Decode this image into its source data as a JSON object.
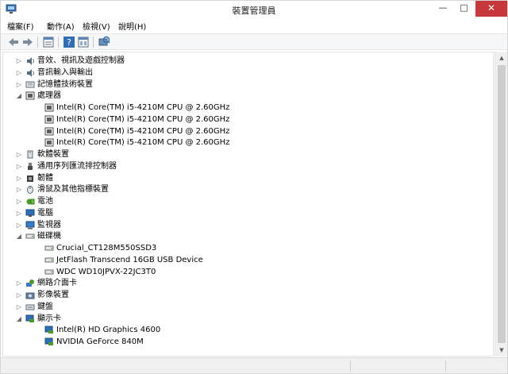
{
  "window": {
    "title": "裝置管理員",
    "buttons": {
      "minimize": "—",
      "maximize": "□",
      "close": "✕"
    }
  },
  "menu": {
    "items": [
      "檔案(F)",
      "動作(A)",
      "檢視(V)",
      "說明(H)"
    ]
  },
  "toolbar": {
    "buttons": [
      "back-icon",
      "forward-icon",
      "properties-icon",
      "help-icon",
      "view-icon",
      "scan-hardware-icon"
    ]
  },
  "tree": {
    "rows": [
      {
        "label": "音效、視訊及遊戲控制器",
        "expander": "▷",
        "icon": "speaker-icon"
      },
      {
        "label": "音訊輸入與輸出",
        "expander": "▷",
        "icon": "speaker-icon"
      },
      {
        "label": "記憶體技術裝置",
        "expander": "▷",
        "icon": "memory-icon"
      },
      {
        "label": "處理器",
        "expander": "◢",
        "icon": "processor-icon"
      },
      {
        "label": "Intel(R) Core(TM) i5-4210M CPU @ 2.60GHz",
        "expander": "",
        "icon": "processor-icon"
      },
      {
        "label": "Intel(R) Core(TM) i5-4210M CPU @ 2.60GHz",
        "expander": "",
        "icon": "processor-icon"
      },
      {
        "label": "Intel(R) Core(TM) i5-4210M CPU @ 2.60GHz",
        "expander": "",
        "icon": "processor-icon"
      },
      {
        "label": "Intel(R) Core(TM) i5-4210M CPU @ 2.60GHz",
        "expander": "",
        "icon": "processor-icon"
      },
      {
        "label": "軟體裝置",
        "expander": "▷",
        "icon": "software-device-icon"
      },
      {
        "label": "通用序列匯流排控制器",
        "expander": "▷",
        "icon": "usb-icon"
      },
      {
        "label": "韌體",
        "expander": "▷",
        "icon": "firmware-icon"
      },
      {
        "label": "滑鼠及其他指標裝置",
        "expander": "▷",
        "icon": "mouse-icon"
      },
      {
        "label": "電池",
        "expander": "▷",
        "icon": "battery-icon"
      },
      {
        "label": "電腦",
        "expander": "▷",
        "icon": "computer-icon"
      },
      {
        "label": "監視器",
        "expander": "▷",
        "icon": "monitor-icon"
      },
      {
        "label": "磁碟機",
        "expander": "◢",
        "icon": "disk-drive-icon"
      },
      {
        "label": "Crucial_CT128M550SSD3",
        "expander": "",
        "icon": "disk-drive-icon"
      },
      {
        "label": "JetFlash Transcend 16GB USB Device",
        "expander": "",
        "icon": "disk-drive-icon"
      },
      {
        "label": "WDC WD10JPVX-22JC3T0",
        "expander": "",
        "icon": "disk-drive-icon"
      },
      {
        "label": "網路介面卡",
        "expander": "▷",
        "icon": "network-adapter-icon"
      },
      {
        "label": "影像裝置",
        "expander": "▷",
        "icon": "imaging-device-icon"
      },
      {
        "label": "鍵盤",
        "expander": "▷",
        "icon": "keyboard-icon"
      },
      {
        "label": "顯示卡",
        "expander": "◢",
        "icon": "display-adapter-icon"
      },
      {
        "label": "Intel(R) HD Graphics 4600",
        "expander": "",
        "icon": "display-adapter-icon"
      },
      {
        "label": "NVIDIA GeForce 840M",
        "expander": "",
        "icon": "display-adapter-icon"
      }
    ]
  },
  "scrollbar": {
    "up": "▲",
    "down": "▼"
  },
  "colors": {
    "close_button": "#c7383c",
    "selection": "#cce8ff",
    "toolbar_bg": "#f5f6f7"
  }
}
